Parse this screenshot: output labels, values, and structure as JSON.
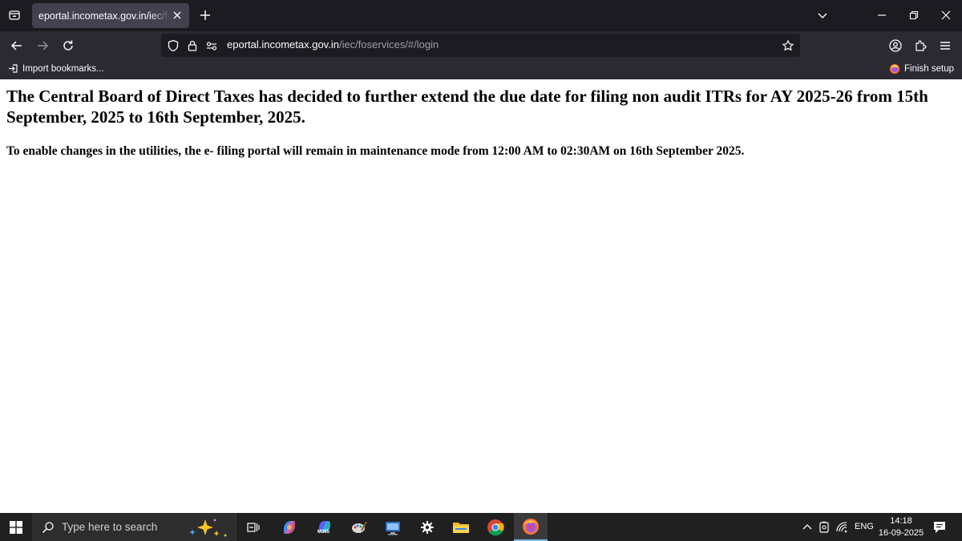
{
  "browser": {
    "tab": {
      "title": "eportal.incometax.gov.in/iec/foservices/#/login"
    },
    "url": {
      "host": "eportal.incometax.gov.in",
      "path": "/iec/foservices/#/login",
      "prefix": ""
    },
    "bookmarks": {
      "import_label": "Import bookmarks...",
      "finish_label": "Finish setup"
    }
  },
  "page": {
    "headline": "The Central Board of Direct Taxes has decided to further extend the due date for filing non audit ITRs for AY 2025-26 from 15th September, 2025 to 16th September, 2025.",
    "notice": "To enable changes in the utilities, the e- filing portal will remain in maintenance mode from 12:00 AM to 02:30AM on 16th September 2025."
  },
  "taskbar": {
    "search_placeholder": "Type here to search",
    "m365_label": "M365",
    "language": "ENG",
    "time": "14:18",
    "date": "16-09-2025"
  },
  "colors": {
    "tabstrip_bg": "#1c1b22",
    "toolbar_bg": "#2b2a33",
    "taskbar_bg": "#202020",
    "active_app_underline": "#76b9ed"
  }
}
